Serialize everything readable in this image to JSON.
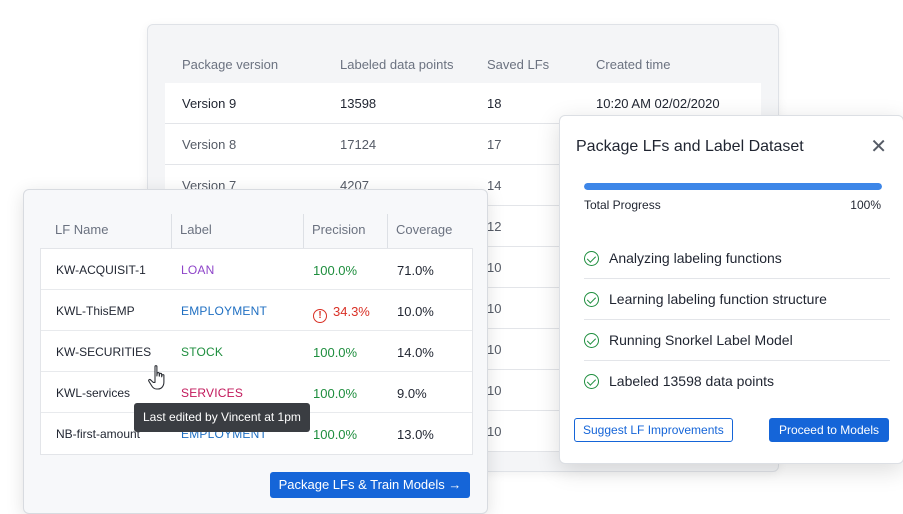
{
  "versions": {
    "headers": [
      "Package version",
      "Labeled data points",
      "Saved LFs",
      "Created time"
    ],
    "rows": [
      {
        "version": "Version 9",
        "points": "13598",
        "lfs": "18",
        "created": "10:20 AM 02/02/2020"
      },
      {
        "version": "Version 8",
        "points": "17124",
        "lfs": "17",
        "created": ""
      },
      {
        "version": "Version 7",
        "points": "4207",
        "lfs": "14",
        "created": ""
      },
      {
        "version": "",
        "points": "",
        "lfs": "12",
        "created": ""
      },
      {
        "version": "",
        "points": "",
        "lfs": "10",
        "created": ""
      },
      {
        "version": "",
        "points": "",
        "lfs": "10",
        "created": ""
      },
      {
        "version": "",
        "points": "",
        "lfs": "10",
        "created": ""
      },
      {
        "version": "",
        "points": "",
        "lfs": "10",
        "created": ""
      },
      {
        "version": "",
        "points": "",
        "lfs": "10",
        "created": ""
      }
    ]
  },
  "lf_table": {
    "headers": [
      "LF Name",
      "Label",
      "Precision",
      "Coverage"
    ],
    "rows": [
      {
        "name": "KW-ACQUISIT-1",
        "label": "LOAN",
        "label_color": "#8e44c9",
        "precision": "100.0%",
        "precision_state": "good",
        "coverage": "71.0%"
      },
      {
        "name": "KWL-ThisEMP",
        "label": "EMPLOYMENT",
        "label_color": "#1f6fc2",
        "precision": "34.3%",
        "precision_state": "warning",
        "coverage": "10.0%"
      },
      {
        "name": "KW-SECURITIES",
        "label": "STOCK",
        "label_color": "#1e8e3e",
        "precision": "100.0%",
        "precision_state": "good",
        "coverage": "14.0%"
      },
      {
        "name": "KWL-services",
        "label": "SERVICES",
        "label_color": "#c2185b",
        "precision": "100.0%",
        "precision_state": "good",
        "coverage": "9.0%"
      },
      {
        "name": "NB-first-amount",
        "label": "EMPLOYMENT",
        "label_color": "#1f6fc2",
        "precision": "100.0%",
        "precision_state": "good",
        "coverage": "13.0%"
      }
    ],
    "tooltip": "Last edited by Vincent at 1pm",
    "train_button": "Package LFs & Train Models →"
  },
  "modal": {
    "title": "Package LFs and Label Dataset",
    "close_icon": "close-icon",
    "progress": {
      "label": "Total Progress",
      "percent_text": "100%",
      "value": 1.0
    },
    "steps": [
      "Analyzing labeling functions",
      "Learning labeling function structure",
      "Running Snorkel Label Model",
      "Labeled 13598 data points"
    ],
    "suggest_button": "Suggest LF Improvements",
    "proceed_button": "Proceed to Models"
  },
  "colors": {
    "primary": "#1565d8",
    "progress": "#3d86e8",
    "success": "#1e8e3e",
    "danger": "#d93025"
  }
}
